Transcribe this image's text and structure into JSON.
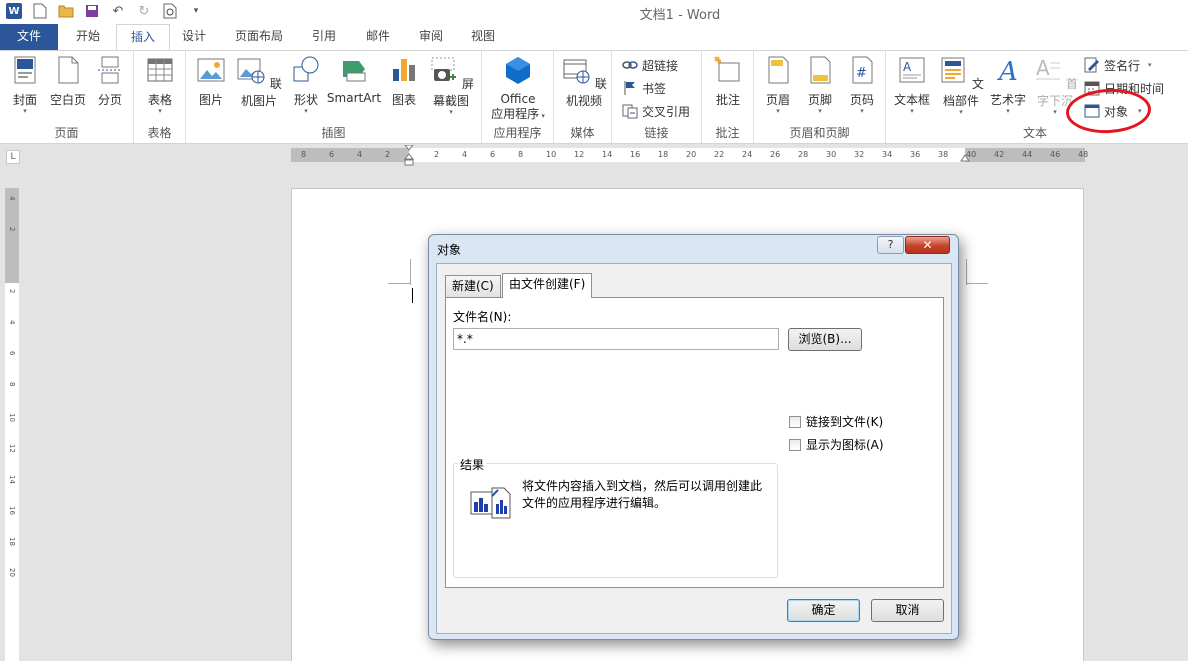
{
  "app": {
    "title": "文档1 - Word",
    "accent": "#2b579a"
  },
  "tabs": [
    {
      "label": "文件"
    },
    {
      "label": "开始"
    },
    {
      "label": "插入"
    },
    {
      "label": "设计"
    },
    {
      "label": "页面布局"
    },
    {
      "label": "引用"
    },
    {
      "label": "邮件"
    },
    {
      "label": "审阅"
    },
    {
      "label": "视图"
    }
  ],
  "ribbon": {
    "pages": {
      "label": "页面",
      "cover": "封面",
      "blank": "空白页",
      "break": "分页"
    },
    "tables": {
      "label": "表格",
      "table": "表格"
    },
    "illustrations": {
      "label": "插图",
      "picture": "图片",
      "online_picture": "联机图片",
      "shapes": "形状",
      "smartart": "SmartArt",
      "chart": "图表",
      "screenshot": "屏幕截图"
    },
    "apps": {
      "label": "应用程序",
      "office_line1": "Office",
      "office_line2": "应用程序"
    },
    "media": {
      "label": "媒体",
      "online_video": "联机视频"
    },
    "links": {
      "label": "链接",
      "hyperlink": "超链接",
      "bookmark": "书签",
      "cross_ref": "交叉引用"
    },
    "comments": {
      "label": "批注",
      "comment": "批注"
    },
    "header_footer": {
      "label": "页眉和页脚",
      "header": "页眉",
      "footer": "页脚",
      "page_number": "页码"
    },
    "text": {
      "label": "文本",
      "textbox": "文本框",
      "quick_parts": "文档部件",
      "wordart": "艺术字",
      "dropcap": "首字下沉",
      "signature": "签名行",
      "datetime": "日期和时间",
      "object": "对象"
    }
  },
  "ruler": {
    "left_labels": [
      "8",
      "6",
      "4",
      "2"
    ],
    "right_labels": [
      "2",
      "4",
      "6",
      "8",
      "10",
      "12",
      "14",
      "16",
      "18",
      "20",
      "22",
      "24",
      "26",
      "28",
      "30",
      "32",
      "34",
      "36",
      "38",
      "40",
      "42",
      "44",
      "46",
      "48"
    ],
    "corner": "L"
  },
  "dialog": {
    "title": "对象",
    "help": "?",
    "close": "✕",
    "tab_new": "新建(C)",
    "tab_from_file": "由文件创建(F)",
    "file_name_label": "文件名(N):",
    "file_name_value": "*.*",
    "browse": "浏览(B)...",
    "link_to_file": "链接到文件(K)",
    "display_as_icon": "显示为图标(A)",
    "result_label": "结果",
    "result_text": "将文件内容插入到文档，然后可以调用创建此文件的应用程序进行编辑。",
    "ok": "确定",
    "cancel": "取消"
  }
}
